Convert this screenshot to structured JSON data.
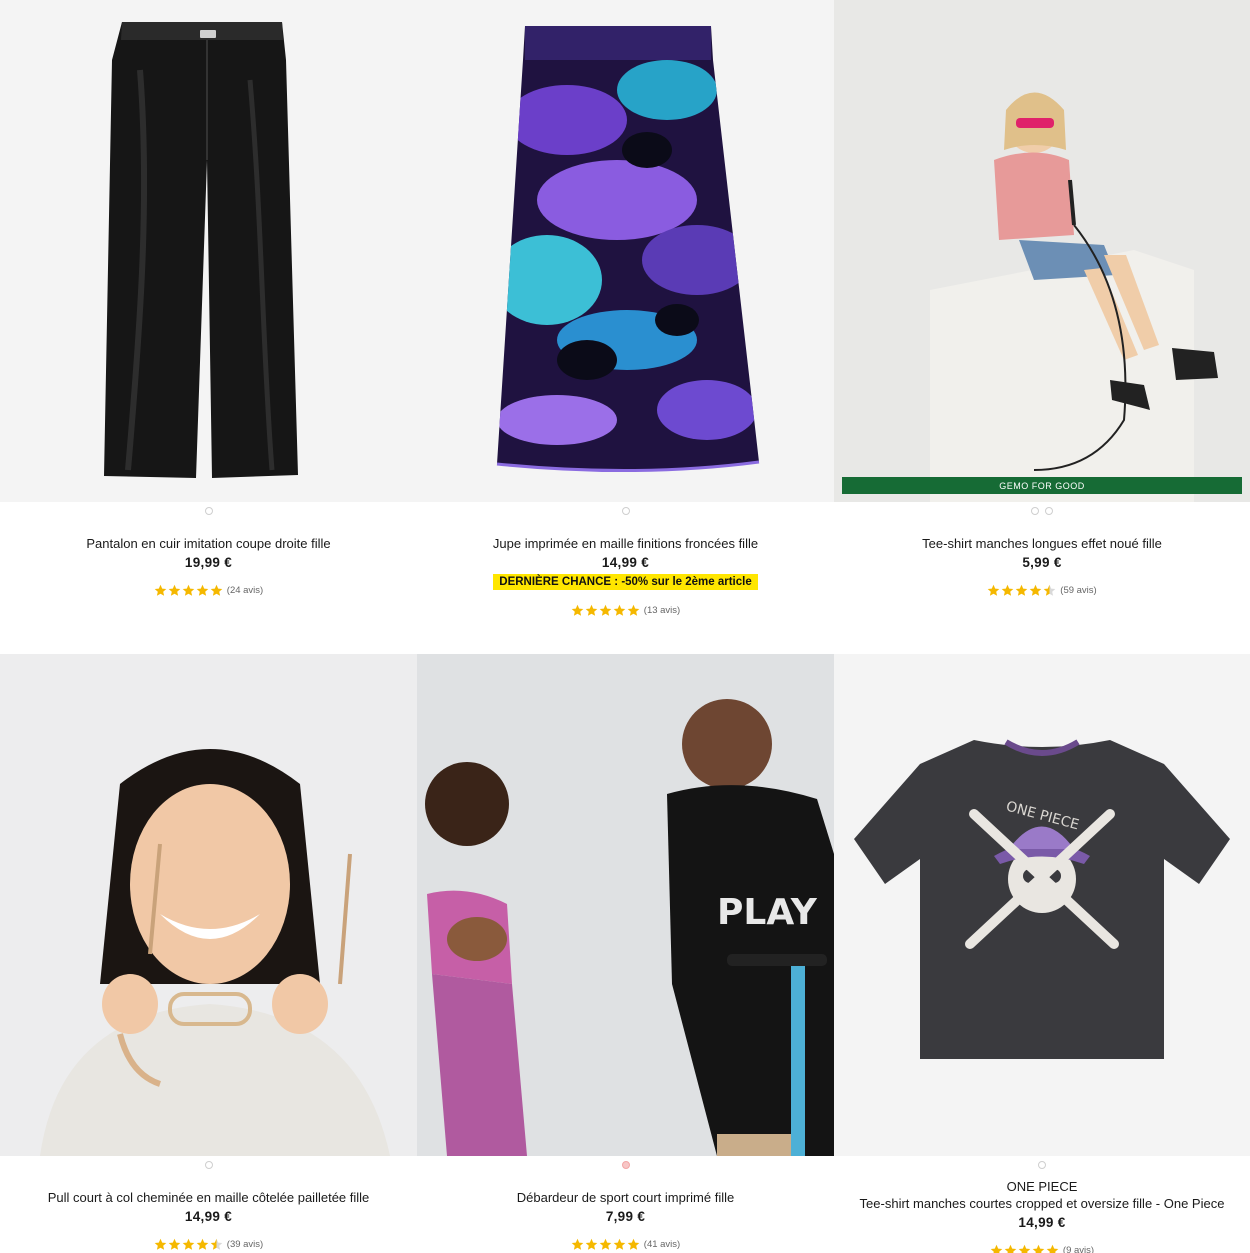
{
  "colors": {
    "accent_star": "#f5b800",
    "promo_bg": "#ffe600",
    "eco_badge_bg": "#166b35",
    "active_dot": "#f7c6c6"
  },
  "products": [
    {
      "brand": "",
      "title": "Pantalon en cuir imitation coupe droite fille",
      "price": "19,99 €",
      "promo": "",
      "rating": 5,
      "reviews": "(24 avis)",
      "badge": "",
      "dots": 1,
      "active_dot": -1
    },
    {
      "brand": "",
      "title": "Jupe imprimée en maille finitions froncées fille",
      "price": "14,99 €",
      "promo_label": "DERNIÈRE CHANCE :",
      "promo_rest": "-50% sur le 2ème article",
      "rating": 5,
      "reviews": "(13 avis)",
      "badge": "",
      "dots": 1,
      "active_dot": -1
    },
    {
      "brand": "",
      "title": "Tee-shirt manches longues effet noué fille",
      "price": "5,99 €",
      "promo": "",
      "rating": 4.5,
      "reviews": "(59 avis)",
      "badge": "GEMO FOR GOOD",
      "dots": 2,
      "active_dot": -1
    },
    {
      "brand": "",
      "title": "Pull court à col cheminée en maille côtelée pailletée fille",
      "price": "14,99 €",
      "promo": "",
      "rating": 4.5,
      "reviews": "(39 avis)",
      "badge": "",
      "dots": 1,
      "active_dot": -1
    },
    {
      "brand": "",
      "title": "Débardeur de sport court imprimé fille",
      "price": "7,99 €",
      "promo": "",
      "rating": 5,
      "reviews": "(41 avis)",
      "badge": "",
      "dots": 1,
      "active_dot": 0
    },
    {
      "brand": "ONE PIECE",
      "title": "Tee-shirt manches courtes cropped et oversize fille - One Piece",
      "price": "14,99 €",
      "promo": "",
      "rating": 5,
      "reviews": "(9 avis)",
      "badge": "",
      "dots": 1,
      "active_dot": -1
    }
  ]
}
